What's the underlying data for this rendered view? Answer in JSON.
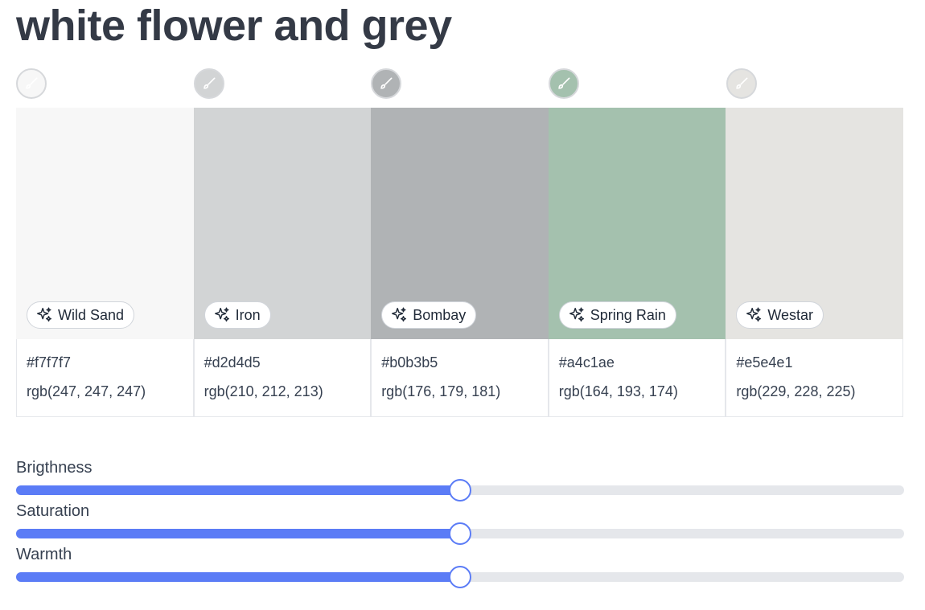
{
  "page": {
    "title": "white flower and grey"
  },
  "palette": {
    "colors": [
      {
        "name": "Wild Sand",
        "hex": "#f7f7f7",
        "rgb": "rgb(247, 247, 247)",
        "swatch_color": "#f7f7f7",
        "brush_icon_color": "#ffffff"
      },
      {
        "name": "Iron",
        "hex": "#d2d4d5",
        "rgb": "rgb(210, 212, 213)",
        "swatch_color": "#d2d4d5",
        "brush_icon_color": "#ffffff"
      },
      {
        "name": "Bombay",
        "hex": "#b0b3b5",
        "rgb": "rgb(176, 179, 181)",
        "swatch_color": "#b0b3b5",
        "brush_icon_color": "#ffffff"
      },
      {
        "name": "Spring Rain",
        "hex": "#a4c1ae",
        "rgb": "rgb(164, 193, 174)",
        "swatch_color": "#a4c1ae",
        "brush_icon_color": "#ffffff"
      },
      {
        "name": "Westar",
        "hex": "#e5e4e1",
        "rgb": "rgb(229, 228, 225)",
        "swatch_color": "#e5e4e1",
        "brush_icon_color": "#ffffff"
      }
    ],
    "name_icon": "sparkles-icon",
    "brush_icon": "paintbrush-icon"
  },
  "sliders": [
    {
      "label": "Brigthness",
      "value": 0.5
    },
    {
      "label": "Saturation",
      "value": 0.5
    },
    {
      "label": "Warmth",
      "value": 0.5
    }
  ],
  "colors": {
    "accent": "#5b7cf6",
    "track": "#e5e7eb",
    "title": "#343a46"
  }
}
